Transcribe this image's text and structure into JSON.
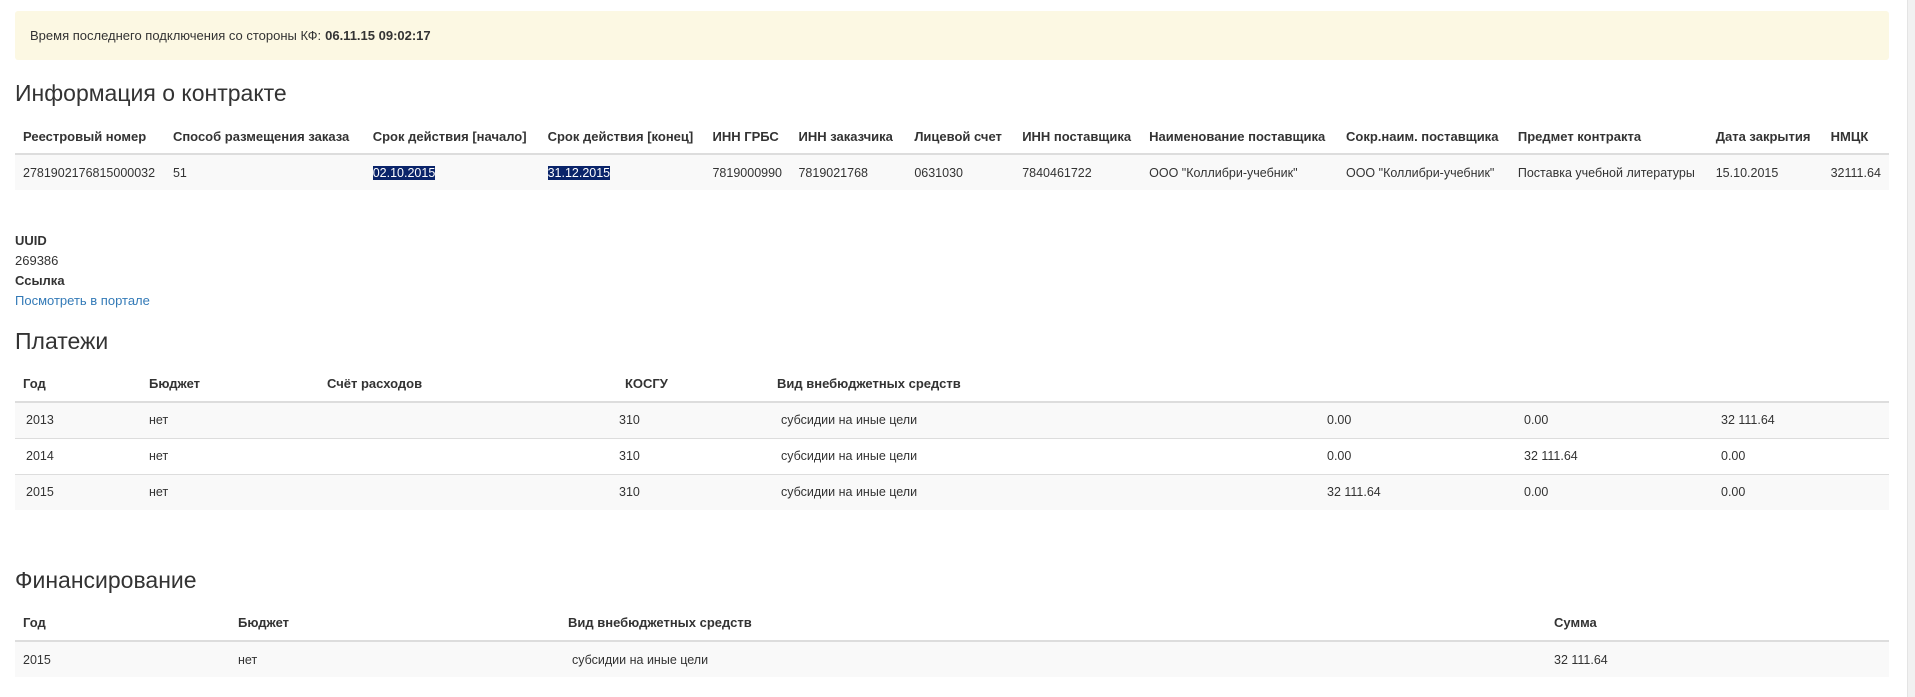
{
  "notice": {
    "label": "Время последнего подключения со стороны КФ:",
    "value": "06.11.15 09:02:17"
  },
  "contract": {
    "title": "Информация о контракте",
    "headers": [
      "Реестровый номер",
      "Способ размещения заказа",
      "Срок действия [начало]",
      "Срок действия [конец]",
      "ИНН ГРБС",
      "ИНН заказчика",
      "Лицевой счет",
      "ИНН поставщика",
      "Наименование поставщика",
      "Сокр.наим. поставщика",
      "Предмет контракта",
      "Дата закрытия",
      "НМЦК"
    ],
    "row": [
      "2781902176815000032",
      "51",
      "02.10.2015",
      "31.12.2015",
      "7819000990",
      "7819021768",
      "0631030",
      "7840461722",
      "ООО \"Коллибри-учебник\"",
      "ООО \"Коллибри-учебник\"",
      "Поставка учебной литературы",
      "15.10.2015",
      "32111.64"
    ]
  },
  "meta": {
    "uuid_label": "UUID",
    "uuid_value": "269386",
    "link_label": "Ссылка",
    "link_text": "Посмотреть в портале"
  },
  "payments": {
    "title": "Платежи",
    "headers": [
      "Год",
      "Бюджет",
      "Счёт расходов",
      "КОСГУ",
      "Вид внебюджетных средств",
      "",
      "",
      ""
    ],
    "rows": [
      [
        "2013",
        "нет",
        "",
        "310",
        "субсидии на иные цели",
        "0.00",
        "0.00",
        "32 111.64"
      ],
      [
        "2014",
        "нет",
        "",
        "310",
        "субсидии на иные цели",
        "0.00",
        "32 111.64",
        "0.00"
      ],
      [
        "2015",
        "нет",
        "",
        "310",
        "субсидии на иные цели",
        "32 111.64",
        "0.00",
        "0.00"
      ]
    ]
  },
  "financing": {
    "title": "Финансирование",
    "headers": [
      "Год",
      "Бюджет",
      "Вид внебюджетных средств",
      "Сумма"
    ],
    "rows": [
      [
        "2015",
        "нет",
        "субсидии на иные цели",
        "32 111.64"
      ]
    ]
  }
}
